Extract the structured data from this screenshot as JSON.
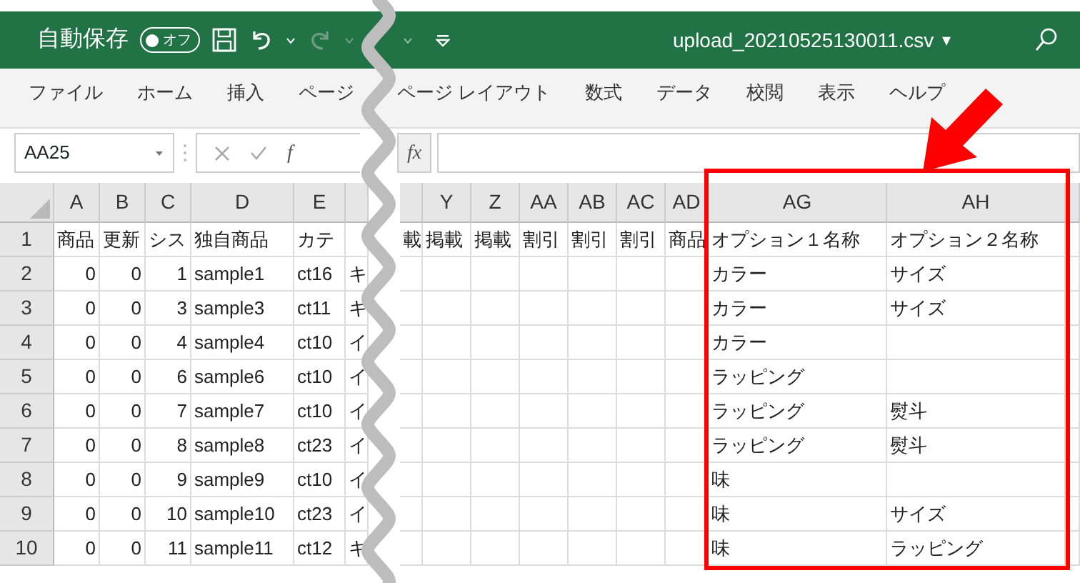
{
  "title_bar": {
    "autosave_label": "自動保存",
    "autosave_toggle": {
      "label": "オフ",
      "on": false
    },
    "filename": "upload_20210525130011.csv",
    "filename_caret": "▾"
  },
  "ribbon_tabs": [
    "ファイル",
    "ホーム",
    "挿入",
    "ページ",
    "ページ レイアウト",
    "数式",
    "データ",
    "校閲",
    "表示",
    "ヘルプ"
  ],
  "formula_bar": {
    "name_box": "AA25",
    "fx_cut": "f",
    "fx": "fx"
  },
  "sheet": {
    "columns": [
      {
        "kind": "text",
        "header": "A"
      },
      {
        "kind": "text",
        "header": "B"
      },
      {
        "kind": "text",
        "header": "C"
      },
      {
        "kind": "text",
        "header": "D"
      },
      {
        "kind": "text",
        "header": "E"
      },
      {
        "kind": "cut"
      },
      {
        "kind": "cut"
      },
      {
        "kind": "text",
        "header": "Y"
      },
      {
        "kind": "text",
        "header": "Z"
      },
      {
        "kind": "text",
        "header": "AA"
      },
      {
        "kind": "text",
        "header": "AB"
      },
      {
        "kind": "text",
        "header": "AC"
      },
      {
        "kind": "text",
        "header": "AD"
      },
      {
        "kind": "wide",
        "header": "AG"
      },
      {
        "kind": "wide",
        "header": "AH"
      },
      {
        "kind": "cut"
      }
    ],
    "rows": [
      {
        "number": "1",
        "cells": [
          "商品",
          "更新",
          "シス",
          "独自商品",
          "カテ",
          null,
          "載",
          "掲載",
          "掲載",
          "割引",
          "割引",
          "割引",
          "商品",
          "オプション１名称",
          "オプション２名称",
          null
        ]
      },
      {
        "number": "2",
        "cells": [
          "0",
          "0",
          "1",
          "sample1",
          "ct16",
          "キ",
          null,
          null,
          null,
          null,
          null,
          null,
          null,
          "カラー",
          "サイズ",
          null
        ]
      },
      {
        "number": "3",
        "cells": [
          "0",
          "0",
          "3",
          "sample3",
          "ct11",
          "キ",
          null,
          null,
          null,
          null,
          null,
          null,
          null,
          "カラー",
          "サイズ",
          null
        ]
      },
      {
        "number": "4",
        "cells": [
          "0",
          "0",
          "4",
          "sample4",
          "ct10",
          "イ",
          null,
          null,
          null,
          null,
          null,
          null,
          null,
          "カラー",
          null,
          null
        ]
      },
      {
        "number": "5",
        "cells": [
          "0",
          "0",
          "6",
          "sample6",
          "ct10",
          "イ",
          null,
          null,
          null,
          null,
          null,
          null,
          null,
          "ラッピング",
          null,
          null
        ]
      },
      {
        "number": "6",
        "cells": [
          "0",
          "0",
          "7",
          "sample7",
          "ct10",
          "イ",
          null,
          null,
          null,
          null,
          null,
          null,
          null,
          "ラッピング",
          "熨斗",
          null
        ]
      },
      {
        "number": "7",
        "cells": [
          "0",
          "0",
          "8",
          "sample8",
          "ct23",
          "イ",
          null,
          null,
          null,
          null,
          null,
          null,
          null,
          "ラッピング",
          "熨斗",
          null
        ]
      },
      {
        "number": "8",
        "cells": [
          "0",
          "0",
          "9",
          "sample9",
          "ct10",
          "イ",
          null,
          null,
          null,
          null,
          null,
          null,
          null,
          "味",
          null,
          null
        ]
      },
      {
        "number": "9",
        "cells": [
          "0",
          "0",
          "10",
          "sample10",
          "ct23",
          "イ",
          null,
          null,
          null,
          null,
          null,
          null,
          null,
          "味",
          "サイズ",
          null
        ]
      },
      {
        "number": "10",
        "cells": [
          "0",
          "0",
          "11",
          "sample11",
          "ct12",
          "キ",
          null,
          null,
          null,
          null,
          null,
          null,
          null,
          "味",
          "ラッピング",
          null
        ]
      }
    ]
  }
}
